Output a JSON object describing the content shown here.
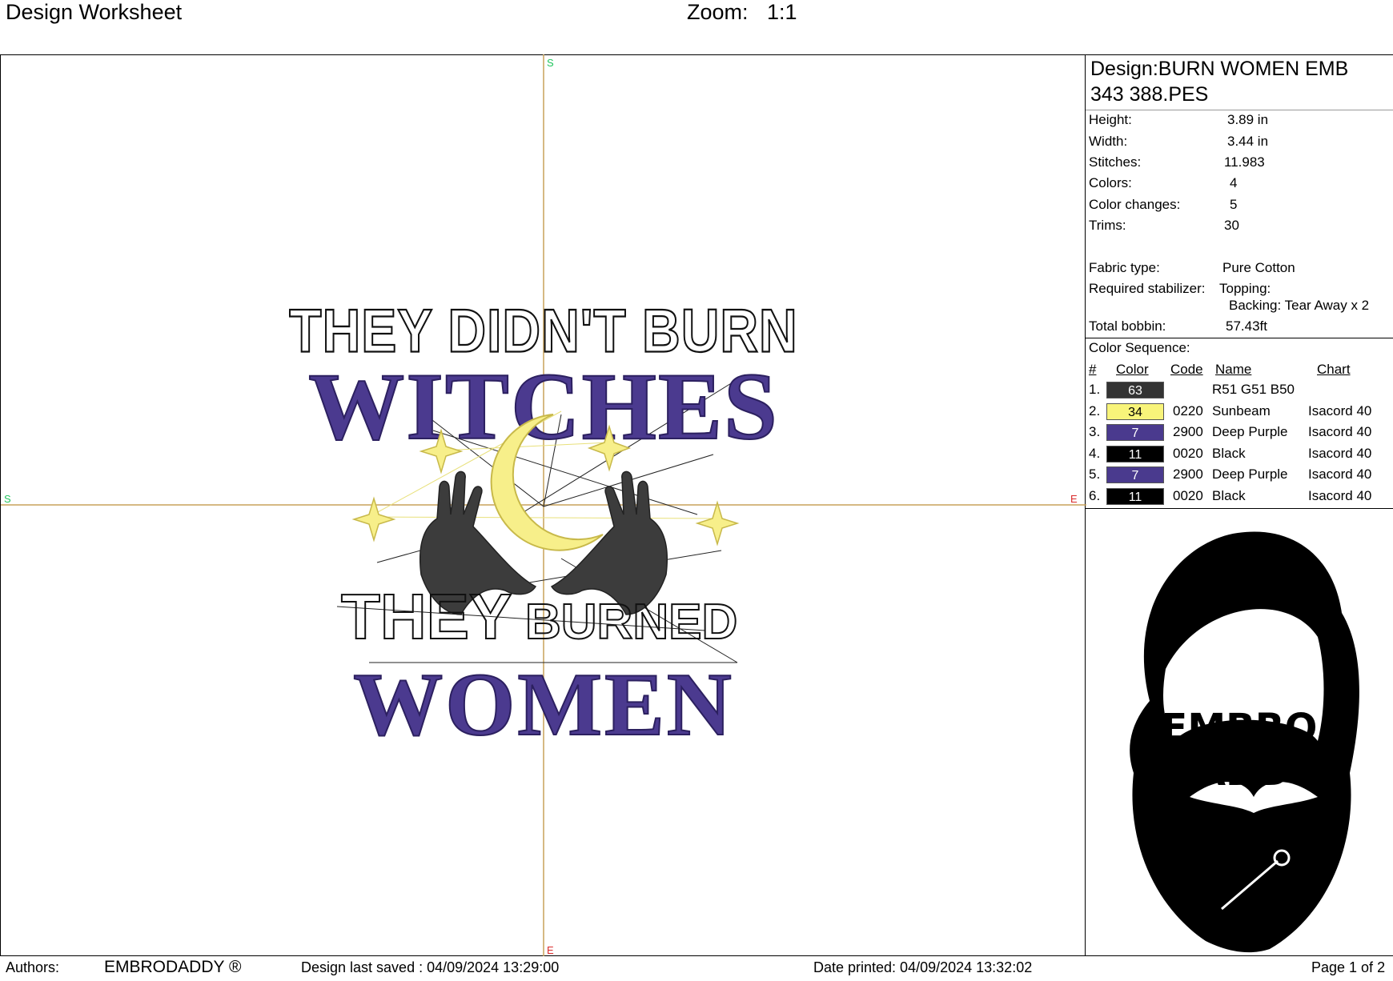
{
  "header": {
    "title": "Design Worksheet",
    "zoom_label": "Zoom:",
    "zoom_value": "1:1"
  },
  "canvas": {
    "axis_marks": {
      "top": "S",
      "left": "S",
      "right": "E",
      "bottom": "E"
    },
    "design_text": {
      "line1": "THEY DIDN'T BURN",
      "line2": "WITCHES",
      "line3a": "THEY",
      "line3b": "BURNED",
      "line4": "WOMEN"
    },
    "colors": {
      "purple": "#4b3a8f",
      "sunbeam": "#f7ef8a",
      "black": "#111111",
      "axis": "#c9a25a"
    }
  },
  "info": {
    "design_name": "Design:BURN WOMEN EMB 343 388.PES",
    "stats": [
      {
        "label": "Height:",
        "value": "3.89 in"
      },
      {
        "label": "Width:",
        "value": "3.44 in"
      },
      {
        "label": "Stitches:",
        "value": "11.983"
      },
      {
        "label": "Colors:",
        "value": "4"
      },
      {
        "label": "Color changes:",
        "value": "5"
      },
      {
        "label": "Trims:",
        "value": "30"
      }
    ],
    "fabric_label": "Fabric type:",
    "fabric_value": "Pure Cotton",
    "stabilizer_label": "Required stabilizer:",
    "topping": "Topping:",
    "backing": "Backing: Tear Away x 2",
    "bobbin_label": "Total bobbin:",
    "bobbin_value": "57.43ft",
    "sequence_title": "Color Sequence:",
    "headers": {
      "num": "#",
      "color": "Color",
      "code": "Code",
      "name": "Name",
      "chart": "Chart"
    },
    "sequence": [
      {
        "num": "1.",
        "swatch": "63",
        "color": "#333333",
        "text_color": "#ffffff",
        "code": "",
        "name": "R51 G51 B50",
        "chart": ""
      },
      {
        "num": "2.",
        "swatch": "34",
        "color": "#f8f47a",
        "text_color": "#000000",
        "code": "0220",
        "name": "Sunbeam",
        "chart": "Isacord 40"
      },
      {
        "num": "3.",
        "swatch": "7",
        "color": "#4a3a8e",
        "text_color": "#ffffff",
        "code": "2900",
        "name": "Deep Purple",
        "chart": "Isacord 40"
      },
      {
        "num": "4.",
        "swatch": "11",
        "color": "#000000",
        "text_color": "#ffffff",
        "code": "0020",
        "name": "Black",
        "chart": "Isacord 40"
      },
      {
        "num": "5.",
        "swatch": "7",
        "color": "#4a3a8e",
        "text_color": "#ffffff",
        "code": "2900",
        "name": "Deep Purple",
        "chart": "Isacord 40"
      },
      {
        "num": "6.",
        "swatch": "11",
        "color": "#000000",
        "text_color": "#ffffff",
        "code": "0020",
        "name": "Black",
        "chart": "Isacord 40"
      }
    ]
  },
  "logo": {
    "line1": "EMBRO",
    "line2": "DADDY"
  },
  "footer": {
    "authors_label": "Authors:",
    "authors_value": "EMBRODADDY ®",
    "saved": "Design last saved : 04/09/2024 13:29:00",
    "printed": "Date printed: 04/09/2024 13:32:02",
    "page": "Page 1 of 2"
  }
}
